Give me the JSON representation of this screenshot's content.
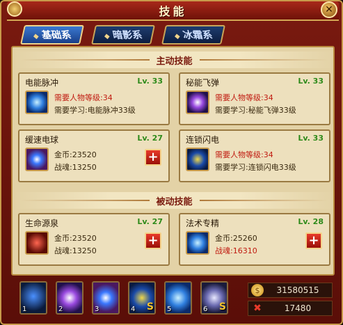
{
  "window": {
    "title": "技能",
    "close_icon": "close-icon"
  },
  "tabs": [
    {
      "label": "基础系",
      "active": true
    },
    {
      "label": "暗影系",
      "active": false
    },
    {
      "label": "冰霜系",
      "active": false
    }
  ],
  "sections": {
    "active": {
      "label": "主动技能"
    },
    "passive": {
      "label": "被动技能"
    }
  },
  "skills": [
    {
      "name": "电能脉冲",
      "level": "Lv. 33",
      "icon": "lightning-pulse-icon",
      "line1": "需要人物等级:34",
      "line2": "需要学习:电能脉冲33级",
      "locked": true
    },
    {
      "name": "秘能飞弹",
      "level": "Lv. 33",
      "icon": "arcane-missile-icon",
      "line1": "需要人物等级:34",
      "line2": "需要学习:秘能飞弹33级",
      "locked": true
    },
    {
      "name": "缓速电球",
      "level": "Lv. 27",
      "icon": "slow-orb-icon",
      "line1": "金币:23520",
      "line2": "战魂:13250",
      "locked": false
    },
    {
      "name": "连锁闪电",
      "level": "Lv. 33",
      "icon": "chain-lightning-icon",
      "line1": "需要人物等级:34",
      "line2": "需要学习:连锁闪电33级",
      "locked": true
    },
    {
      "name": "生命源泉",
      "level": "Lv. 27",
      "icon": "life-fountain-icon",
      "line1": "金币:23520",
      "line2": "战魂:13250",
      "locked": false
    },
    {
      "name": "法术专精",
      "level": "Lv. 28",
      "icon": "spell-mastery-icon",
      "line1": "金币:25260",
      "line2": "战魂:16310",
      "locked": false
    }
  ],
  "hotbar": [
    {
      "num": "1",
      "s": false
    },
    {
      "num": "2",
      "s": false
    },
    {
      "num": "3",
      "s": false
    },
    {
      "num": "4",
      "s": true
    },
    {
      "num": "5",
      "s": false
    },
    {
      "num": "6",
      "s": true
    }
  ],
  "hotbar_badge": "S",
  "resources": {
    "gold": "31580515",
    "soul": "17480"
  },
  "upgrade_label": "+",
  "colors": {
    "accent": "#c89a4a",
    "level_green": "#2e8a1a",
    "warn_red": "#c01a10"
  }
}
